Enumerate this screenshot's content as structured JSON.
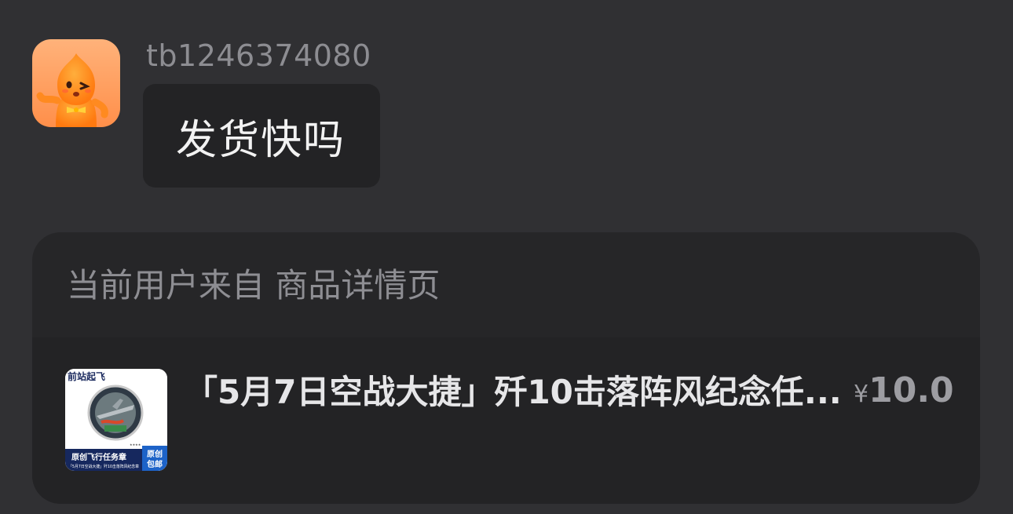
{
  "message": {
    "username": "tb1246374080",
    "text": "发货快吗",
    "avatar_icon": "orange-mascot-avatar"
  },
  "source_card": {
    "label": "当前用户来自 商品详情页",
    "product": {
      "title": "「5月7日空战大捷」歼10击落阵风纪念任...",
      "currency": "¥",
      "price": "10.0",
      "thumbnail": {
        "brand": "前站起飞",
        "caption_main": "原创飞行任务章",
        "caption_sub": "「5月7日空战大捷」歼10击落阵风纪念章",
        "badge_line1": "原创",
        "badge_line2": "包邮"
      }
    }
  },
  "colors": {
    "background": "#303033",
    "bubble": "#232325",
    "card": "#262628",
    "product_row": "#232325",
    "muted_text": "#8e8e93"
  }
}
